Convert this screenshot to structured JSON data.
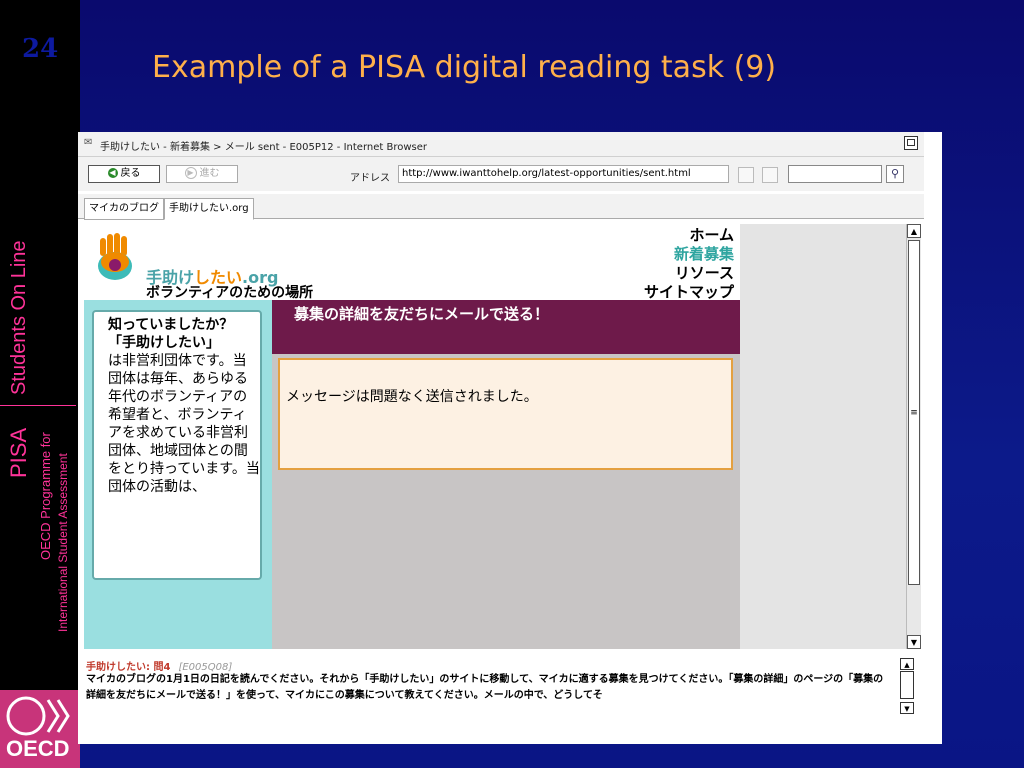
{
  "slide": {
    "number": "24",
    "title": "Example of a PISA digital reading task (9)",
    "sidebar_students": "Students On Line",
    "sidebar_pisa": "PISA",
    "sidebar_oecd_programme": "OECD Programme for",
    "sidebar_intl": "International Student Assessment",
    "oecd_logo": "OECD"
  },
  "browser": {
    "title": "手助けしたい - 新着募集 > メール sent - E005P12 - Internet Browser",
    "back_label": "戻る",
    "forward_label": "進む",
    "address_label": "アドレス",
    "address_value": "http://www.iwanttohelp.org/latest-opportunities/sent.html",
    "tabs": [
      "マイカのブログ",
      "手助けしたい.org"
    ]
  },
  "site": {
    "logo_main": "手助け",
    "logo_highlight": "したい",
    "logo_suffix": ".org",
    "logo_sub": "ボランティアのための場所",
    "nav": [
      "ホーム",
      "新着募集",
      "リソース",
      "サイトマップ"
    ],
    "info_heading": "知っていましたか？",
    "info_subheading": "「手助けしたい」",
    "info_body": "は非営利団体です。当団体は毎年、あらゆる年代のボランティアの希望者と、ボランティアを求めている非営利団体、地域団体との間をとり持っています。当団体の活動は、",
    "banner": "募集の詳細を友だちにメールで送る！",
    "message": "メッセージは問題なく送信されました。"
  },
  "question": {
    "label": "手助けしたい: 問4",
    "code": "[E005Q08]",
    "text": "マイカのブログの1月1日の日記を読んでください。それから「手助けしたい」のサイトに移動して、マイカに適する募集を見つけてください。「募集の詳細」のページの「募集の詳細を友だちにメールで送る！」を使って、マイカにこの募集について教えてください。メールの中で、どうしてそ"
  }
}
